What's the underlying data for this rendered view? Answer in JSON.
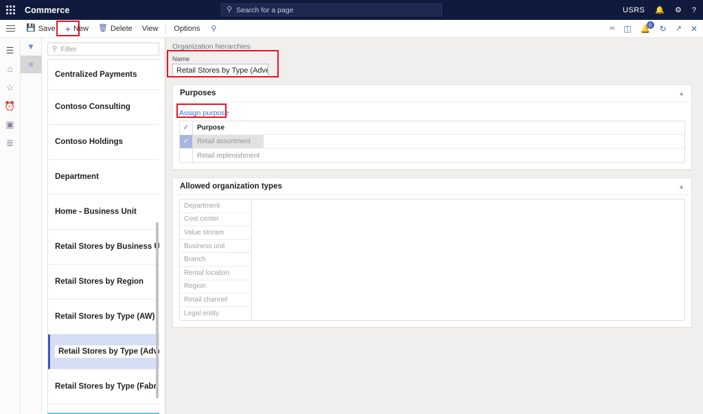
{
  "topnav": {
    "brand": "Commerce",
    "waffle_icon": "app-launcher-icon",
    "search": {
      "placeholder": "Search for a page",
      "icon": "search-icon"
    },
    "user_initials": "USRS",
    "bell_icon": "notifications-icon",
    "settings_icon": "gear-icon",
    "help_icon": "help-icon"
  },
  "toolbar": {
    "hamburger_icon": "hamburger-menu-icon",
    "items": [
      {
        "label": "Save",
        "icon": "save-icon"
      },
      {
        "label": "New",
        "icon": "plus-icon"
      },
      {
        "label": "Delete",
        "icon": "trash-icon"
      },
      {
        "label": "View",
        "icon": ""
      },
      {
        "label": "Options",
        "icon": ""
      }
    ],
    "search_icon": "search-icon",
    "right_icons": {
      "attach": "link-icon",
      "office": "office-app-icon",
      "notify": "notification-bell-icon",
      "notify_count": "0",
      "refresh": "refresh-icon",
      "popout": "open-in-new-window-icon",
      "close": "close-icon"
    }
  },
  "rail": {
    "items": [
      {
        "name": "nav-menu",
        "glyph": "☰"
      },
      {
        "name": "home",
        "glyph": "⌂"
      },
      {
        "name": "favorites",
        "glyph": "☆"
      },
      {
        "name": "recent",
        "glyph": "◴"
      },
      {
        "name": "workspaces",
        "glyph": "▥"
      },
      {
        "name": "modules",
        "glyph": "☰"
      }
    ]
  },
  "rail2": {
    "filter_icon": "filter-funnel-icon",
    "list_icon": "list-view-icon"
  },
  "listpane": {
    "filter_placeholder": "Filter",
    "filter_icon": "search-icon",
    "items": [
      {
        "label": "Centralized Payments",
        "selected": false
      },
      {
        "label": "Contoso Consulting",
        "selected": false
      },
      {
        "label": "Contoso Holdings",
        "selected": false
      },
      {
        "label": "Department",
        "selected": false
      },
      {
        "label": "Home - Business Unit",
        "selected": false
      },
      {
        "label": "Retail Stores by Business Unit",
        "selected": false
      },
      {
        "label": "Retail Stores by Region",
        "selected": false
      },
      {
        "label": "Retail Stores by Type (AW)",
        "selected": false
      },
      {
        "label": "Retail Stores by Type (Advent",
        "selected": true
      },
      {
        "label": "Retail Stores by Type (Fabrik..",
        "selected": false
      }
    ]
  },
  "content": {
    "breadcrumb": "Organization hierarchies",
    "name_label": "Name",
    "name_value": "Retail Stores by Type (Adventur...",
    "purposes": {
      "title": "Purposes",
      "assign_label": "Assign purpose",
      "collapse_icon": "chevron-up-icon",
      "header": "Purpose",
      "rows": [
        {
          "label": "Retail assortment",
          "checked": true,
          "selected": true
        },
        {
          "label": "Retail replenishment",
          "checked": false,
          "selected": false
        }
      ]
    },
    "allowed_types": {
      "title": "Allowed organization types",
      "collapse_icon": "chevron-up-icon",
      "rows": [
        "Department",
        "Cost center",
        "Value stream",
        "Business unit",
        "Branch",
        "Rental location",
        "Region",
        "Retail channel",
        "Legal entity"
      ]
    }
  },
  "colors": {
    "navy": "#0f1a3c",
    "accent": "#4a63b8",
    "highlight_red": "#e81123",
    "selection_blue": "#d6def5",
    "selection_bar": "#3b55c4"
  }
}
